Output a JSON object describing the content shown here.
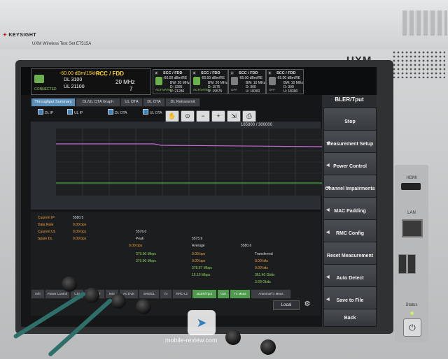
{
  "device": {
    "brand": "KEYSIGHT",
    "product": "UXM Wireless Test Set  E7515A",
    "model": "UXM"
  },
  "status": {
    "pcc": {
      "title": "PCC / FDD",
      "power": "-60.00 dBm/15kHz",
      "dl_earfcn": "3100",
      "ul_earfcn": "21100",
      "bw": "20 MHz",
      "band": "7",
      "state": "CONNECTED"
    },
    "scc": [
      {
        "num": "2",
        "title": "SCC / FDD",
        "power": "-60.00 dBm/RE",
        "bw": "BW: 20 MHz",
        "dl": "3286",
        "ul": "21286",
        "state": "ACTIVATED"
      },
      {
        "num": "3",
        "title": "SCC / FDD",
        "power": "-60.00 dBm/RE",
        "bw": "BW: 20 MHz",
        "dl": "1575",
        "ul": "19575",
        "state": "ACTIVATED"
      },
      {
        "num": "4",
        "title": "SCC / FDD",
        "power": "-65.00 dBm/RE",
        "bw": "BW: 10 MHz",
        "dl": "300",
        "ul": "18300",
        "state": "OFF"
      },
      {
        "num": "5",
        "title": "SCC / FDD",
        "power": "-65.00 dBm/RE",
        "bw": "BW: 10 MHz",
        "dl": "300",
        "ul": "18300",
        "state": "OFF"
      }
    ]
  },
  "tabs": [
    "Throughput Summary",
    "DL/UL OTA Graph",
    "UL OTA",
    "DL OTA",
    "DL Retransmit"
  ],
  "legend": [
    "DL IP",
    "UL IP",
    "DL OTA",
    "UL OTA"
  ],
  "counter": "185800 / 300000",
  "zoom_icons": [
    "hand-icon",
    "zoom-reset-icon",
    "zoom-out-icon",
    "zoom-in-icon",
    "export-icon",
    "print-icon"
  ],
  "table": {
    "rows": [
      {
        "label": "Cuurent IP",
        "c1": "5580.5",
        "c2": "",
        "c3": "",
        "c4": ""
      },
      {
        "label": "Data Rate",
        "c1": "",
        "c2": "0.00 bps",
        "c3": "",
        "c4": ""
      },
      {
        "label": "Cuurent UL",
        "c1": "",
        "c2": "0.00 bps",
        "c3": "5576.0",
        "c4": ""
      },
      {
        "label": "Spare DL",
        "c1": "",
        "c2": "0.00 bps",
        "c3": "Peak",
        "c4": "5575.9"
      },
      {
        "label": "",
        "c1": "",
        "c2": "0.00 bps",
        "c3": "Average",
        "c4": "5580.6"
      },
      {
        "label": "",
        "c1": "",
        "c2": "379.90 Mbps",
        "c3": "0.00 bps",
        "c4": "Transferred"
      },
      {
        "label": "",
        "c1": "",
        "c2": "379.90 Mbps",
        "c3": "0.00 bps",
        "c4": "0.00 bits"
      },
      {
        "label": "",
        "c1": "",
        "c2": "",
        "c3": "378.67 Mbps",
        "c4": "0.00 bits"
      },
      {
        "label": "",
        "c1": "",
        "c2": "",
        "c3": "15.10 Mbps",
        "c4": "361.40 Gbits"
      },
      {
        "label": "",
        "c1": "",
        "c2": "",
        "c3": "",
        "c4": "3.68 Gbits"
      }
    ],
    "bottom_tabs": [
      "Info",
      "Power Control",
      "CSI",
      "Physical",
      "IMS",
      "ACTIVE",
      "SRS/DL",
      "Tx",
      "RRC-L1",
      "BLER/Tput",
      "GSI",
      "Tx Meas",
      "Antenna/Tx Meas"
    ]
  },
  "right_panel": {
    "header": "BLER/Tput",
    "buttons": [
      "Stop",
      "Measurement Setup",
      "Power Control",
      "Channel Impairments",
      "MAC Padding",
      "RMC Config",
      "Reset Measurement",
      "Auto Detect",
      "Save to File",
      "Back"
    ]
  },
  "local_label": "Local",
  "ports": {
    "hdmi": "HDMI",
    "lan": "LAN",
    "status": "Status"
  },
  "watermark": "mobile-review.com"
}
